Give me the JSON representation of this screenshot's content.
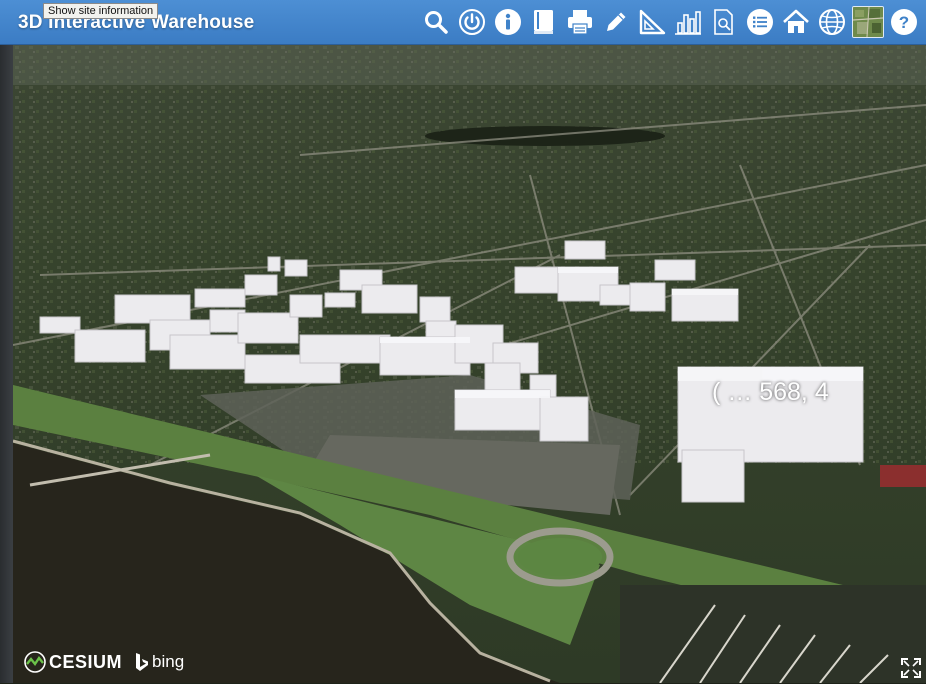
{
  "app": {
    "title": "3D Interactive Warehouse"
  },
  "tooltip": {
    "text": "Show site information"
  },
  "toolbar": {
    "tools": [
      {
        "id": "search",
        "icon": "search-icon"
      },
      {
        "id": "power",
        "icon": "power-icon"
      },
      {
        "id": "info",
        "icon": "info-icon"
      },
      {
        "id": "book",
        "icon": "book-icon"
      },
      {
        "id": "print",
        "icon": "print-icon"
      },
      {
        "id": "draw",
        "icon": "pencil-icon"
      },
      {
        "id": "measure",
        "icon": "set-square-icon"
      },
      {
        "id": "chart",
        "icon": "bar-chart-icon"
      },
      {
        "id": "report",
        "icon": "document-search-icon"
      },
      {
        "id": "list",
        "icon": "list-icon"
      },
      {
        "id": "home",
        "icon": "home-icon"
      },
      {
        "id": "globe",
        "icon": "globe-icon"
      },
      {
        "id": "basemap",
        "icon": "basemap-thumbnail"
      },
      {
        "id": "help",
        "icon": "help-icon"
      }
    ]
  },
  "viewer": {
    "coordinate_label": "( … 568, 4"
  },
  "credits": {
    "cesium": "CESIUM",
    "bing": "bing"
  },
  "colors": {
    "header_bar": "#3f82c9",
    "building": "#ecebee",
    "water": "#27251c",
    "park": "#5b8040"
  }
}
